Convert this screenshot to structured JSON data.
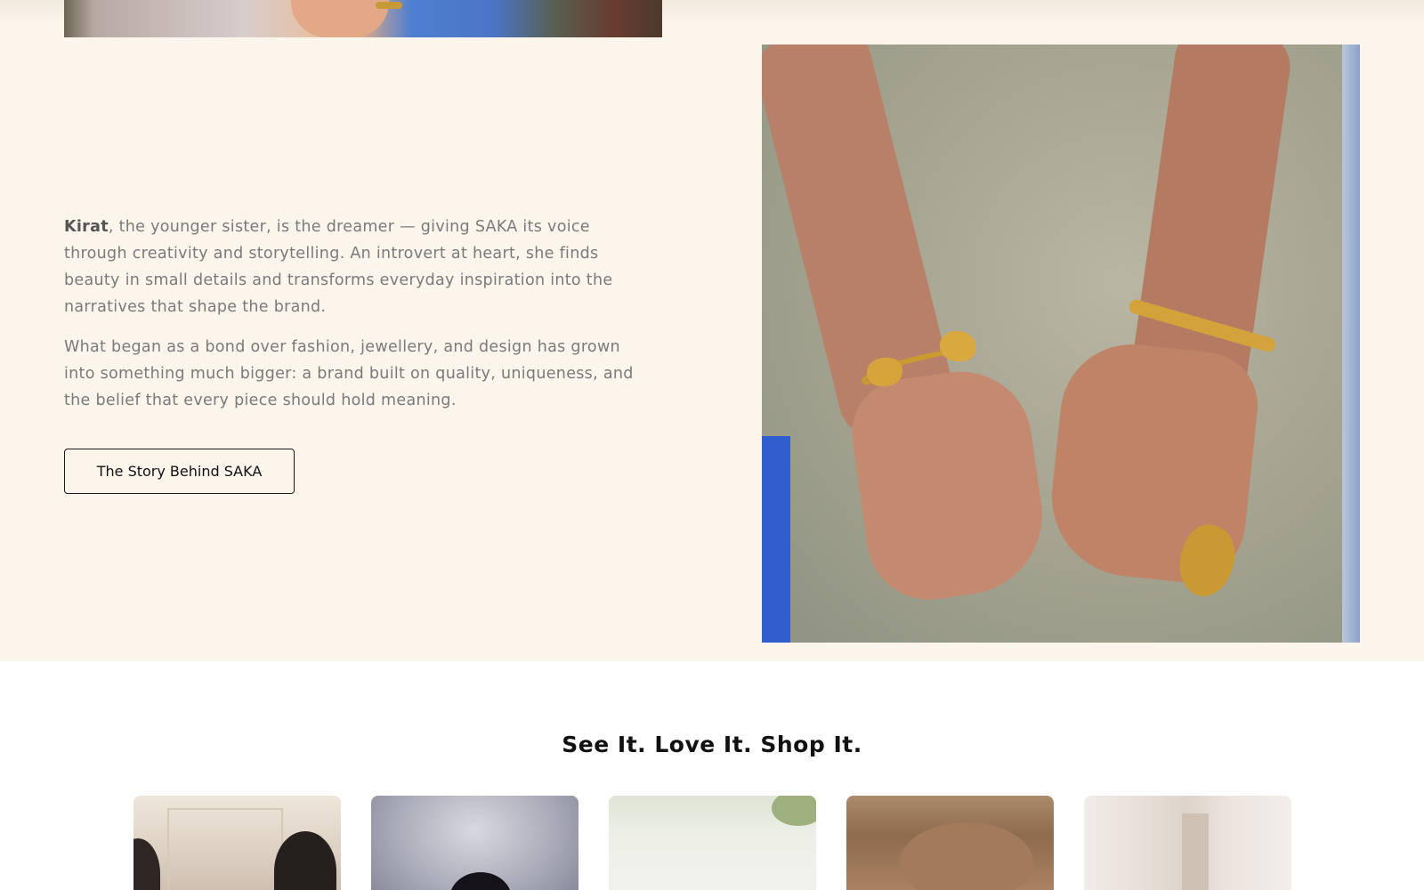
{
  "story": {
    "bio_name": "Kirat",
    "bio_rest": ", the younger sister, is the dreamer — giving SAKA its voice through creativity and storytelling. An introvert at heart, she finds beauty in small details and transforms everyday inspiration into the narratives that shape the brand.",
    "origin": "What began as a bond over fashion, jewellery, and design has grown into something much bigger: a brand built on quality, uniqueness, and the belief that every piece should hold meaning.",
    "button_label": "The Story Behind SAKA"
  },
  "shop": {
    "title": "See It. Love It. Shop It."
  },
  "colors": {
    "section_bg": "#fbf5ec",
    "body_text": "#7a7a7a",
    "heading": "#111111"
  }
}
